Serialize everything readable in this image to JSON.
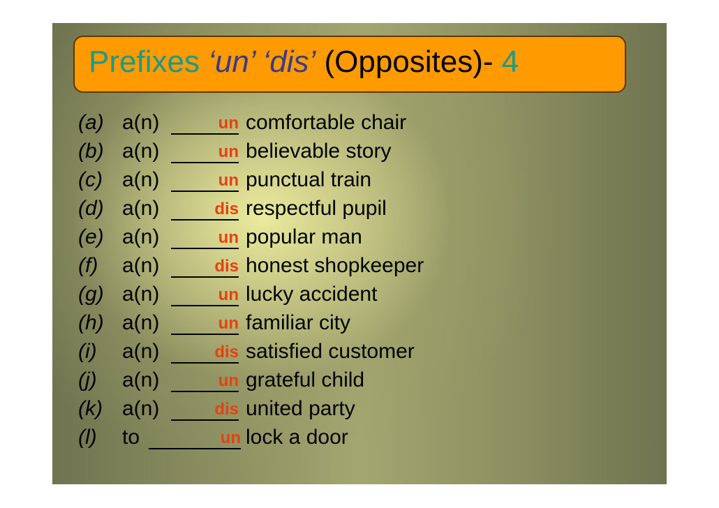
{
  "title": {
    "part1": "Prefixes ",
    "part2": "‘un’ ‘dis’",
    "part3": " (Opposites)- ",
    "part4": "4"
  },
  "colors": {
    "title_box": "#ff9a00",
    "title_teal": "#1a9a8a",
    "title_purple": "#3a3a8c",
    "answer": "#e84010"
  },
  "items": [
    {
      "label": "(a)",
      "article": "a(n)",
      "answer": "un",
      "phrase": "comfortable chair"
    },
    {
      "label": "(b)",
      "article": "a(n)",
      "answer": "un",
      "phrase": "believable story"
    },
    {
      "label": "(c)",
      "article": "a(n)",
      "answer": "un",
      "phrase": "punctual train"
    },
    {
      "label": "(d)",
      "article": "a(n)",
      "answer": "dis",
      "phrase": "respectful pupil"
    },
    {
      "label": "(e)",
      "article": "a(n)",
      "answer": "un",
      "phrase": "popular man"
    },
    {
      "label": "(f)",
      "article": "a(n)",
      "answer": "dis",
      "phrase": "honest shopkeeper"
    },
    {
      "label": "(g)",
      "article": "a(n)",
      "answer": "un",
      "phrase": "lucky accident"
    },
    {
      "label": "(h)",
      "article": "a(n)",
      "answer": "un",
      "phrase": "familiar city"
    },
    {
      "label": "(i)",
      "article": "a(n)",
      "answer": "dis",
      "phrase": "satisfied customer"
    },
    {
      "label": "(j)",
      "article": "a(n)",
      "answer": "un",
      "phrase": "grateful child"
    },
    {
      "label": "(k)",
      "article": "a(n)",
      "answer": "dis",
      "phrase": "united party"
    },
    {
      "label": "(l)",
      "article": "to",
      "answer": "un",
      "phrase": "lock a door"
    }
  ]
}
